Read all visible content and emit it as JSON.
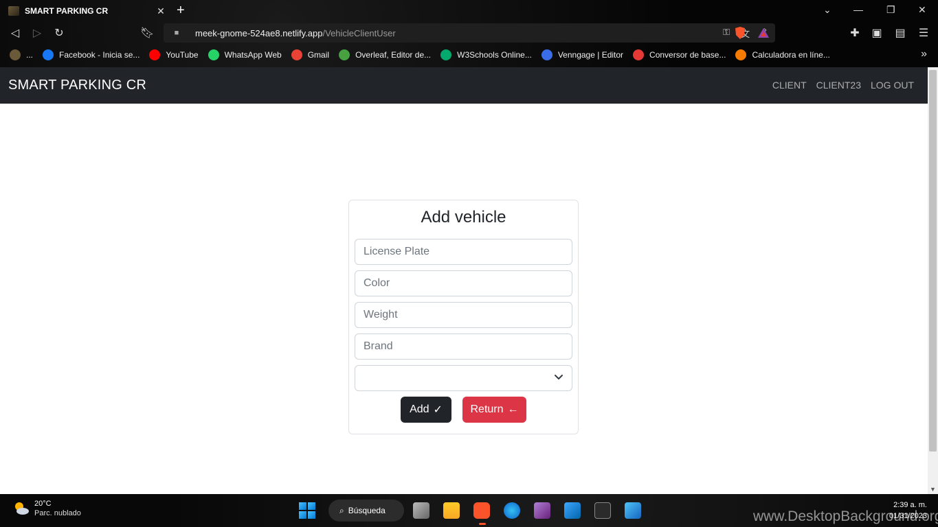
{
  "browser": {
    "tab_title": "SMART PARKING CR",
    "tab_close": "✕",
    "new_tab": "+",
    "url_host": "meek-gnome-524ae8.netlify.app",
    "url_path": "/VehicleClientUser",
    "bookmarks": [
      {
        "label": "...",
        "icon": "app-icon",
        "color": "#6b5a3a"
      },
      {
        "label": "Facebook - Inicia se...",
        "icon": "facebook-icon",
        "color": "#1877f2"
      },
      {
        "label": "YouTube",
        "icon": "youtube-icon",
        "color": "#ff0000"
      },
      {
        "label": "WhatsApp Web",
        "icon": "whatsapp-icon",
        "color": "#25d366"
      },
      {
        "label": "Gmail",
        "icon": "gmail-icon",
        "color": "#ea4335"
      },
      {
        "label": "Overleaf, Editor de...",
        "icon": "overleaf-icon",
        "color": "#47a141"
      },
      {
        "label": "W3Schools Online...",
        "icon": "w3schools-icon",
        "color": "#04aa6d"
      },
      {
        "label": "Venngage | Editor",
        "icon": "venngage-icon",
        "color": "#3a6ee8"
      },
      {
        "label": "Conversor de base...",
        "icon": "converter-icon",
        "color": "#e53935"
      },
      {
        "label": "Calculadora en líne...",
        "icon": "calculator-icon",
        "color": "#f57c00"
      }
    ]
  },
  "navbar": {
    "brand": "SMART PARKING CR",
    "links": [
      "CLIENT",
      "CLIENT23",
      "LOG OUT"
    ]
  },
  "form": {
    "title": "Add vehicle",
    "fields": [
      {
        "placeholder": "License Plate",
        "value": ""
      },
      {
        "placeholder": "Color",
        "value": ""
      },
      {
        "placeholder": "Weight",
        "value": ""
      },
      {
        "placeholder": "Brand",
        "value": ""
      }
    ],
    "select_value": "",
    "add_label": "Add",
    "add_icon": "✓",
    "return_label": "Return",
    "return_icon": "←"
  },
  "taskbar": {
    "weather_temp": "20°C",
    "weather_desc": "Parc. nublado",
    "search_label": "Búsqueda",
    "time": "2:39 a. m.",
    "date": "01/31/2023"
  },
  "watermark": "www.DesktopBackground.org",
  "colors": {
    "navbar": "#212529",
    "add_button": "#212529",
    "return_button": "#dc3545"
  }
}
